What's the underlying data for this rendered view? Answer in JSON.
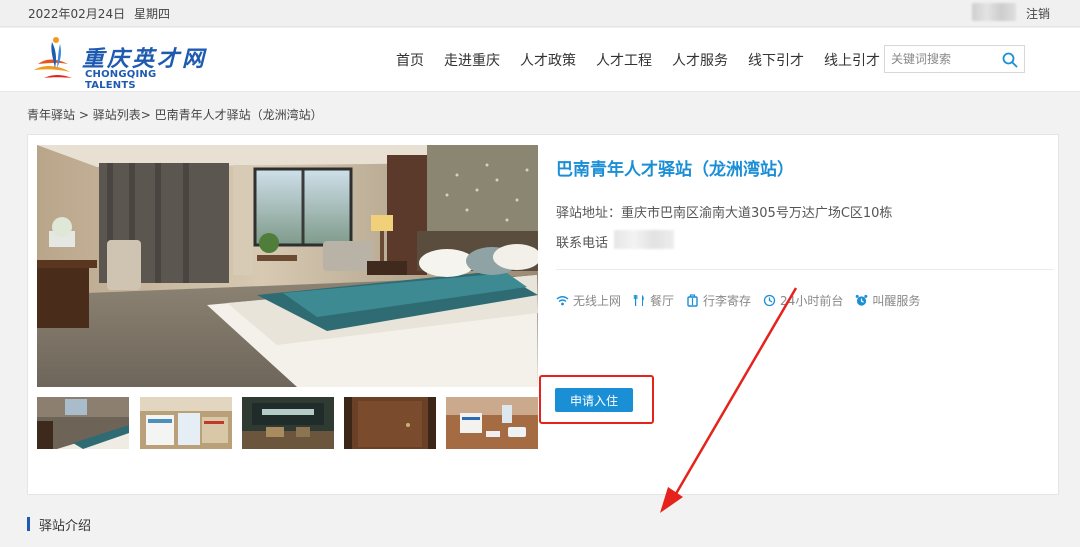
{
  "topbar": {
    "date": "2022年02月24日",
    "weekday": "星期四",
    "logout": "注销"
  },
  "logo": {
    "cn": "重庆英才网",
    "en": "CHONGQING TALENTS"
  },
  "nav": {
    "items": [
      {
        "label": "首页"
      },
      {
        "label": "走进重庆"
      },
      {
        "label": "人才政策"
      },
      {
        "label": "人才工程"
      },
      {
        "label": "人才服务"
      },
      {
        "label": "线下引才"
      },
      {
        "label": "线上引才"
      }
    ]
  },
  "search": {
    "placeholder": "关键词搜索"
  },
  "breadcrumb": {
    "item1": "青年驿站",
    "sep1": " > ",
    "item2": "驿站列表",
    "sep2": "> ",
    "item3": "巴南青年人才驿站（龙洲湾站）"
  },
  "station": {
    "title": "巴南青年人才驿站（龙洲湾站）",
    "address": "驿站地址：重庆市巴南区渝南大道305号万达广场C区10栋",
    "phone_label": "联系电话",
    "amenities": [
      {
        "icon": "wifi-icon",
        "label": "无线上网"
      },
      {
        "icon": "restaurant-icon",
        "label": "餐厅"
      },
      {
        "icon": "luggage-icon",
        "label": "行李寄存"
      },
      {
        "icon": "reception-icon",
        "label": "24小时前台"
      },
      {
        "icon": "alarm-clock-icon",
        "label": "叫醒服务"
      }
    ],
    "apply_button": "申请入住"
  },
  "section": {
    "intro_heading": "驿站介绍"
  },
  "colors": {
    "accent": "#1a8fd6",
    "brand": "#1e5bb0",
    "highlight": "#e5221b"
  }
}
